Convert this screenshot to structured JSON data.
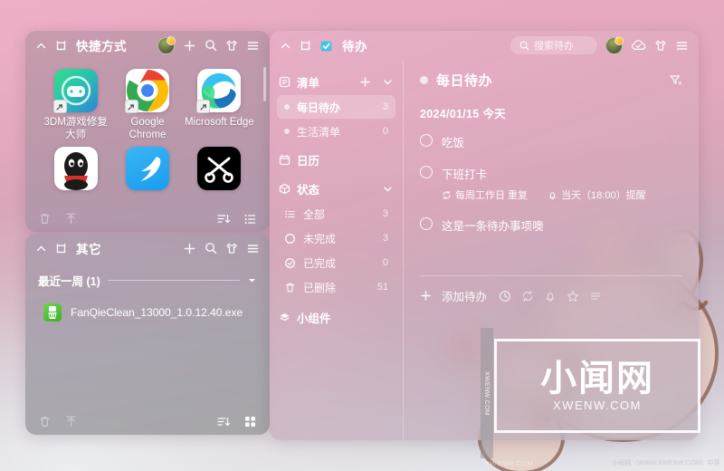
{
  "wallpaper": {
    "gradient_top": "#eeb0c8",
    "gradient_bottom": "#eef0f3",
    "illustration": "rabbit-illustration",
    "heart_color": "#e8584f"
  },
  "shortcuts_panel": {
    "header": {
      "collapse_icon": "chevron-up-icon",
      "pin_icon": "pin-icon",
      "title": "快捷方式",
      "avatar": "user-avatar",
      "add_icon": "plus-icon",
      "search_icon": "search-icon",
      "shirt_icon": "shirt-icon",
      "menu_icon": "hamburger-menu-icon"
    },
    "apps": [
      {
        "name": "3DM游戏修复大师",
        "icon": "3dm-game-repair-icon",
        "shortcut_badge": true
      },
      {
        "name": "Google Chrome",
        "icon": "chrome-icon",
        "shortcut_badge": true
      },
      {
        "name": "Microsoft Edge",
        "icon": "edge-icon",
        "shortcut_badge": true
      },
      {
        "name": "QQ",
        "icon": "qq-icon",
        "shortcut_badge": false
      },
      {
        "name": "钉钉",
        "icon": "dingtalk-icon",
        "shortcut_badge": false
      },
      {
        "name": "剪映",
        "icon": "capcut-icon",
        "shortcut_badge": false
      }
    ],
    "bottom_bar": {
      "delete_icon": "trash-icon",
      "upload_icon": "upload-icon",
      "sort_icon": "sort-icon",
      "list_view_icon": "list-view-icon"
    }
  },
  "other_panel": {
    "header": {
      "collapse_icon": "chevron-up-icon",
      "pin_icon": "pin-icon",
      "title": "其它",
      "add_icon": "plus-icon",
      "search_icon": "search-icon",
      "shirt_icon": "shirt-icon",
      "menu_icon": "hamburger-menu-icon"
    },
    "group": {
      "label": "最近一周 (1)",
      "collapse_icon": "chevron-down-icon"
    },
    "files": [
      {
        "name": "FanQieClean_13000_1.0.12.40.exe",
        "icon": "cleaner-exe-icon"
      }
    ],
    "bottom_bar": {
      "delete_icon": "trash-icon",
      "upload_icon": "upload-icon",
      "sort_icon": "sort-icon",
      "grid_view_icon": "grid-view-icon"
    }
  },
  "todo_panel": {
    "header": {
      "collapse_icon": "chevron-up-icon",
      "pin_icon": "pin-icon",
      "app_icon": "todo-check-icon",
      "title": "待办",
      "search_placeholder": "搜索待办",
      "search_icon": "search-icon",
      "avatar": "user-avatar",
      "cloud_icon": "cloud-sync-icon",
      "shirt_icon": "shirt-icon",
      "menu_icon": "hamburger-menu-icon"
    },
    "sidebar": {
      "lists_section": {
        "icon": "list-section-icon",
        "label": "清单",
        "add_icon": "plus-icon",
        "collapse_icon": "chevron-down-icon"
      },
      "lists": [
        {
          "label": "每日待办",
          "count": "3",
          "active": true
        },
        {
          "label": "生活清单",
          "count": "0",
          "active": false
        }
      ],
      "calendar": {
        "icon": "calendar-icon",
        "label": "日历"
      },
      "status_section": {
        "icon": "status-cube-icon",
        "label": "状态",
        "collapse_icon": "chevron-down-icon"
      },
      "statuses": [
        {
          "label": "全部",
          "count": "3",
          "icon": "all-list-icon"
        },
        {
          "label": "未完成",
          "count": "3",
          "icon": "circle-icon"
        },
        {
          "label": "已完成",
          "count": "0",
          "icon": "check-circle-icon"
        },
        {
          "label": "已删除",
          "count": "51",
          "icon": "trash-icon"
        }
      ],
      "widgets": {
        "icon": "widgets-icon",
        "label": "小组件"
      }
    },
    "main": {
      "list_title": "每日待办",
      "filter_icon": "filter-icon",
      "date_group": "2024/01/15  今天",
      "tasks": [
        {
          "text": "吃饭",
          "checked": false,
          "meta": []
        },
        {
          "text": "下班打卡",
          "checked": false,
          "meta": [
            {
              "icon": "repeat-icon",
              "text": "每周工作日  重复"
            },
            {
              "icon": "bell-icon",
              "text": "当天（18:00）提醒"
            }
          ]
        },
        {
          "text": "这是一条待办事项噢",
          "checked": false,
          "meta": []
        }
      ],
      "add_row": {
        "plus_icon": "plus-icon",
        "label": "添加待办",
        "clock_icon": "clock-icon",
        "repeat_icon": "repeat-icon",
        "bell_icon": "bell-icon",
        "star_icon": "star-icon",
        "list_icon": "list-icon"
      }
    }
  },
  "watermark": {
    "cn": "小闻网",
    "en": "XWENW.COM",
    "strip_text": "XWENW.COM",
    "footer_left": "XWENW.COM",
    "footer_right": "小闻网（WWW.XWENW.COM）中英"
  }
}
